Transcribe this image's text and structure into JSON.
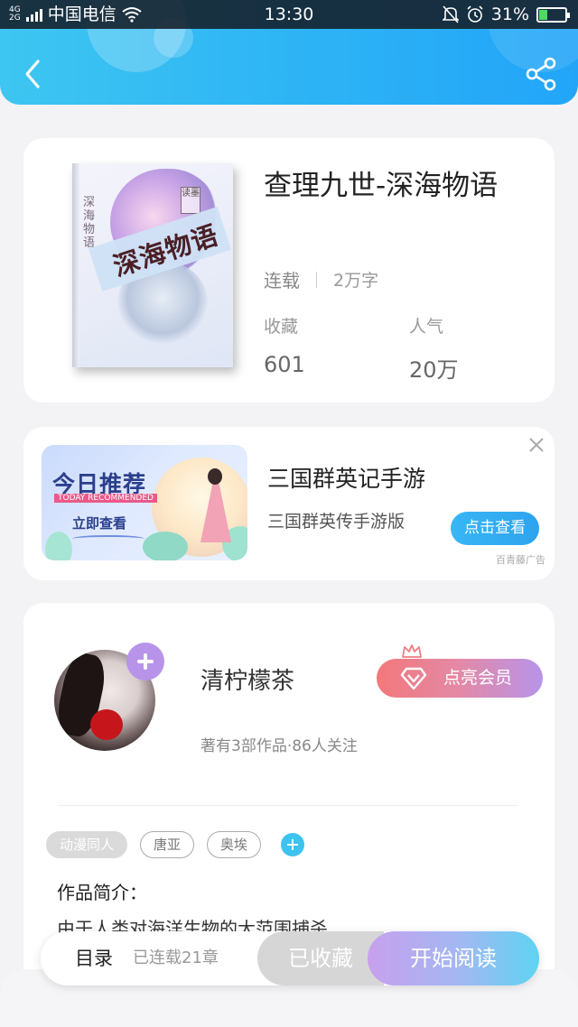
{
  "status_bar": {
    "network_gen": "4G",
    "network_gen2": "2G",
    "carrier": "中国电信",
    "time": "13:30",
    "battery_percent": "31%",
    "battery_level": 0.31
  },
  "header": {
    "back_icon": "chevron-left-icon",
    "share_icon": "share-icon"
  },
  "book": {
    "cover_title": "深海物语",
    "cover_vertical_text": "深海物语",
    "cover_stamp": "读墨",
    "title": "查理九世-深海物语",
    "status": "连载",
    "word_count": "2万字",
    "stats": [
      {
        "label": "收藏",
        "value": "601"
      },
      {
        "label": "人气",
        "value": "20万"
      }
    ]
  },
  "ad": {
    "banner_headline": "今日推荐",
    "banner_sub": "TODAY RECOMMENDED",
    "banner_cta": "立即查看",
    "title": "三国群英记手游",
    "subtitle": "三国群英传手游版",
    "button_label": "点击查看",
    "source": "百青藤广告",
    "close_icon": "close-icon"
  },
  "author": {
    "name": "清柠檬茶",
    "stats": "著有3部作品·86人关注",
    "vip_label": "点亮会员",
    "tags": [
      "动漫同人",
      "唐亚",
      "奥埃"
    ],
    "intro_label": "作品简介：",
    "intro_text": "由于人类对海洋生物的大范围捕杀"
  },
  "bottom_bar": {
    "toc_label": "目录",
    "toc_count": "已连载21章",
    "collect_label": "已收藏",
    "read_label": "开始阅读"
  },
  "colors": {
    "header_gradient_start": "#3ec6f1",
    "header_gradient_end": "#22a5f8",
    "accent_blue": "#38b6f5",
    "vip_gradient_start": "#f3787a",
    "vip_gradient_end": "#b794ea"
  }
}
